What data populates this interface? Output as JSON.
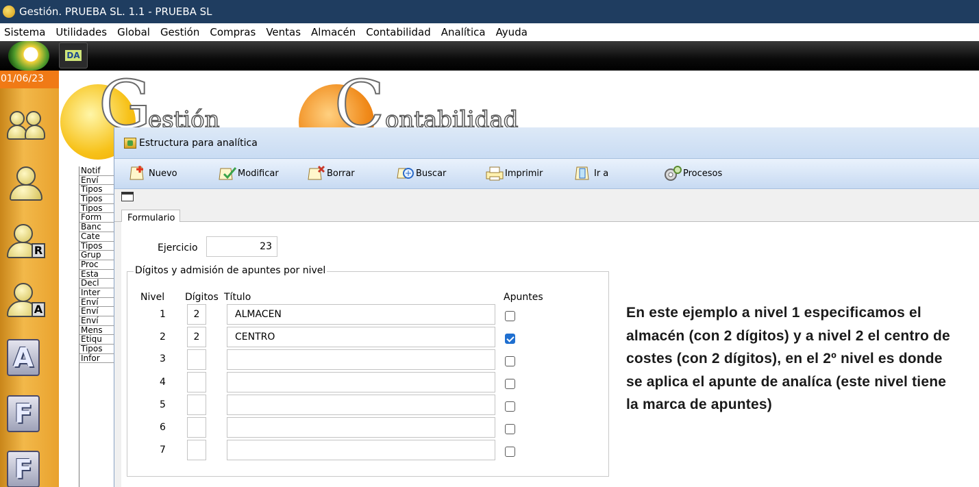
{
  "window_title": "Gestión. PRUEBA SL. 1.1 - PRUEBA SL",
  "menu": [
    "Sistema",
    "Utilidades",
    "Global",
    "Gestión",
    "Compras",
    "Ventas",
    "Almacén",
    "Contabilidad",
    "Analítica",
    "Ayuda"
  ],
  "toolstrip": {
    "small_button_label": "DA"
  },
  "sidebar": {
    "date": "01/06/23",
    "letter_buttons": [
      "R",
      "A",
      "A",
      "F",
      "F"
    ]
  },
  "background": {
    "logo_letters": [
      "G",
      "C"
    ],
    "logo_words": [
      "estión",
      "ontabilidad"
    ],
    "list_items": [
      "Notif",
      "Enví",
      "Tipos",
      "Tipos",
      "Tipos",
      "Form",
      "Banc",
      "Cate",
      "Tipos",
      "Grup",
      "Proc",
      "Esta",
      "Decl",
      "Inter",
      "Enví",
      "Enví",
      "Enví",
      "Mens",
      "Etiqu",
      "Tipos",
      "Infor"
    ]
  },
  "dialog": {
    "title": "Estructura para analítica",
    "toolbar": {
      "nuevo": "Nuevo",
      "modificar": "Modificar",
      "borrar": "Borrar",
      "buscar": "Buscar",
      "imprimir": "Imprimir",
      "ir_a": "Ir a",
      "procesos": "Procesos"
    },
    "tab": "Formulario",
    "ejercicio_label": "Ejercicio",
    "ejercicio_value": "23",
    "group_label": "Dígitos y admisión de apuntes por nivel",
    "columns": {
      "nivel": "Nivel",
      "digitos": "Dígitos",
      "titulo": "Título",
      "apuntes": "Apuntes"
    },
    "rows": [
      {
        "nivel": "1",
        "digitos": "2",
        "titulo": "ALMACEN",
        "apuntes": false
      },
      {
        "nivel": "2",
        "digitos": "2",
        "titulo": "CENTRO",
        "apuntes": true
      },
      {
        "nivel": "3",
        "digitos": "",
        "titulo": "",
        "apuntes": false
      },
      {
        "nivel": "4",
        "digitos": "",
        "titulo": "",
        "apuntes": false
      },
      {
        "nivel": "5",
        "digitos": "",
        "titulo": "",
        "apuntes": false
      },
      {
        "nivel": "6",
        "digitos": "",
        "titulo": "",
        "apuntes": false
      },
      {
        "nivel": "7",
        "digitos": "",
        "titulo": "",
        "apuntes": false
      }
    ]
  },
  "annotation": "En este ejemplo a nivel 1 especificamos el almacén (con 2 dígitos) y a nivel 2 el centro de costes (con 2 dígitos), en el 2º nivel es donde se aplica el apunte de analíca (este nivel tiene la marca de apuntes)",
  "colors": {
    "titlebar": "#1f3d60",
    "checkbox_checked": "#1f6fd0",
    "sidebar": "#f2b84a",
    "date_badge": "#f07a16"
  },
  "icons": [
    "app-icon",
    "module-ball-icon",
    "users-icon",
    "user-icon",
    "user-r-icon",
    "user-a-icon",
    "letter-a-icon",
    "letter-f-icon",
    "window-icon",
    "new-icon",
    "edit-icon",
    "delete-icon",
    "search-icon",
    "print-icon",
    "goto-icon",
    "process-icon",
    "table-view-icon"
  ]
}
